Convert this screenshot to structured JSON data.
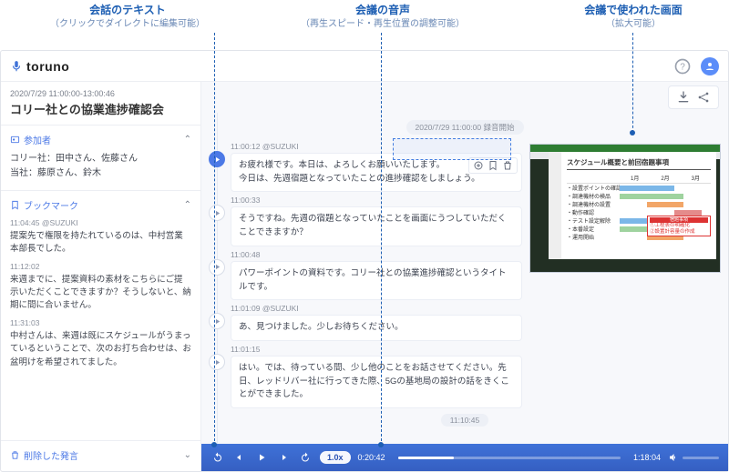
{
  "annotations": {
    "text_title": "会話のテキスト",
    "text_sub": "（クリックでダイレクトに編集可能）",
    "audio_title": "会議の音声",
    "audio_sub": "（再生スピード・再生位置の調整可能）",
    "screen_title": "会議で使われた画面",
    "screen_sub": "（拡大可能）"
  },
  "brand": "toruno",
  "sidebar": {
    "datetime": "2020/7/29 11:00:00-13:00:46",
    "meeting_title": "コリー社との協業進捗確認会",
    "participants_label": "参加者",
    "participants_lines": [
      "コリー社：田中さん、佐藤さん",
      "当社：藤原さん、鈴木"
    ],
    "bookmarks_label": "ブックマーク",
    "bookmarks": [
      {
        "meta": "11:04:45 @SUZUKI",
        "text": "提案先で権限を持たれているのは、中村営業本部長でした。"
      },
      {
        "meta": "11:12:02",
        "text": "来週までに、提案資料の素材をこちらにご提示いただくことできますか？そうしないと、納期に間に合いません。"
      },
      {
        "meta": "11:31:03",
        "text": "中村さんは、来週は既にスケジュールがうまっているということで、次のお打ち合わせは、お盆明けを希望されてました。"
      }
    ],
    "deleted_label": "削除した発言"
  },
  "recordingStart": "2020/7/29 11:00:00 録音開始",
  "recordingMark": "11:10:45",
  "utterances": [
    {
      "meta": "11:00:12 @SUZUKI",
      "text": "お疲れ様です。本日は、よろしくお願いいたします。\n今日は、先週宿題となっていたことの進捗確認をしましょう。",
      "active": true,
      "tools": true
    },
    {
      "meta": "11:00:33",
      "text": "そうですね。先週の宿題となっていたことを画面にうつしていただくことできますか？",
      "active": false
    },
    {
      "meta": "11:00:48",
      "text": "パワーポイントの資料です。コリー社との協業進捗確認というタイトルです。",
      "active": false
    },
    {
      "meta": "11:01:09 @SUZUKI",
      "text": "あ、見つけました。少しお待ちください。",
      "active": false
    },
    {
      "meta": "11:01:15",
      "text": "はい。では、待っている間、少し他のことをお話させてください。先日、レッドリバー社に行ってきた際、5Gの基地局の設計の話をきくことができました。",
      "active": false
    }
  ],
  "player": {
    "speed": "1.0x",
    "current": "0:20:42",
    "total": "1:18:04"
  },
  "slide": {
    "title": "スケジュール概要と前回宿題事項",
    "months": [
      "1月",
      "2月",
      "3月"
    ],
    "rows": [
      "・設置ポイントの確認",
      "・調達機材の検品",
      "・調達機材の設置",
      "・動作確認",
      "・テスト設定解除",
      "・本番設定",
      "・運用開始"
    ],
    "callout1": "①工程表の明確化",
    "callout2": "②設置計容量の作成",
    "callout_head": "宿題事項"
  }
}
